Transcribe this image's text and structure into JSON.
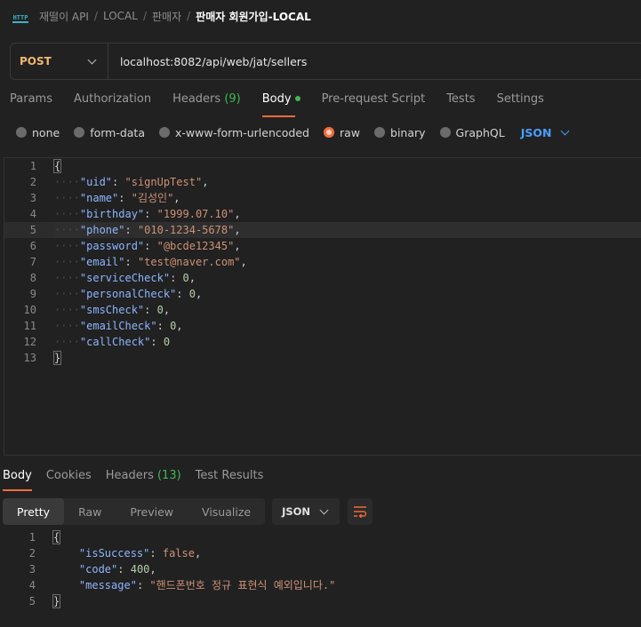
{
  "breadcrumb": {
    "icon_text": "HTTP",
    "collection": "재떨이 API",
    "folder1": "LOCAL",
    "folder2": "판매자",
    "request": "판매자 회원가입-LOCAL"
  },
  "request": {
    "method": "POST",
    "url": "localhost:8082/api/web/jat/sellers"
  },
  "request_tabs": [
    {
      "label": "Params",
      "count": ""
    },
    {
      "label": "Authorization",
      "count": ""
    },
    {
      "label": "Headers",
      "count": "(9)"
    },
    {
      "label": "Body",
      "count": ""
    },
    {
      "label": "Pre-request Script",
      "count": ""
    },
    {
      "label": "Tests",
      "count": ""
    },
    {
      "label": "Settings",
      "count": ""
    }
  ],
  "body_types": [
    "none",
    "form-data",
    "x-www-form-urlencoded",
    "raw",
    "binary",
    "GraphQL"
  ],
  "body_format": "JSON",
  "request_body": [
    {
      "n": "1",
      "open": "{"
    },
    {
      "n": "2",
      "key": "\"uid\"",
      "val": "\"signUpTest\"",
      "type": "str",
      "comma": ","
    },
    {
      "n": "3",
      "key": "\"name\"",
      "val": "\"김성인\"",
      "type": "str",
      "comma": ","
    },
    {
      "n": "4",
      "key": "\"birthday\"",
      "val": "\"1999.07.10\"",
      "type": "str",
      "comma": ","
    },
    {
      "n": "5",
      "key": "\"phone\"",
      "val": "\"010-1234-5678\"",
      "type": "str",
      "comma": ","
    },
    {
      "n": "6",
      "key": "\"password\"",
      "val": "\"@bcde12345\"",
      "type": "str",
      "comma": ","
    },
    {
      "n": "7",
      "key": "\"email\"",
      "val": "\"test@naver.com\"",
      "type": "str",
      "comma": ","
    },
    {
      "n": "8",
      "key": "\"serviceCheck\"",
      "val": "0",
      "type": "num",
      "comma": ","
    },
    {
      "n": "9",
      "key": "\"personalCheck\"",
      "val": "0",
      "type": "num",
      "comma": ","
    },
    {
      "n": "10",
      "key": "\"smsCheck\"",
      "val": "0",
      "type": "num",
      "comma": ","
    },
    {
      "n": "11",
      "key": "\"emailCheck\"",
      "val": "0",
      "type": "num",
      "comma": ","
    },
    {
      "n": "12",
      "key": "\"callCheck\"",
      "val": "0",
      "type": "num",
      "comma": ""
    },
    {
      "n": "13",
      "close": "}"
    }
  ],
  "response_tabs": [
    {
      "label": "Body",
      "count": ""
    },
    {
      "label": "Cookies",
      "count": ""
    },
    {
      "label": "Headers",
      "count": "(13)"
    },
    {
      "label": "Test Results",
      "count": ""
    }
  ],
  "response_views": [
    "Pretty",
    "Raw",
    "Preview",
    "Visualize"
  ],
  "response_format": "JSON",
  "response_body": [
    {
      "n": "1",
      "open": "{"
    },
    {
      "n": "2",
      "key": "\"isSuccess\"",
      "val": "false",
      "type": "bool",
      "comma": ","
    },
    {
      "n": "3",
      "key": "\"code\"",
      "val": "400",
      "type": "num",
      "comma": ","
    },
    {
      "n": "4",
      "key": "\"message\"",
      "val": "\"핸드폰번호 정규 표현식 예외입니다.\"",
      "type": "str",
      "comma": ""
    },
    {
      "n": "5",
      "close": "}"
    }
  ],
  "colors": {
    "accent": "#f26b3a",
    "method": "#f0b86e",
    "success": "#3fb950",
    "link": "#4a9eff"
  }
}
